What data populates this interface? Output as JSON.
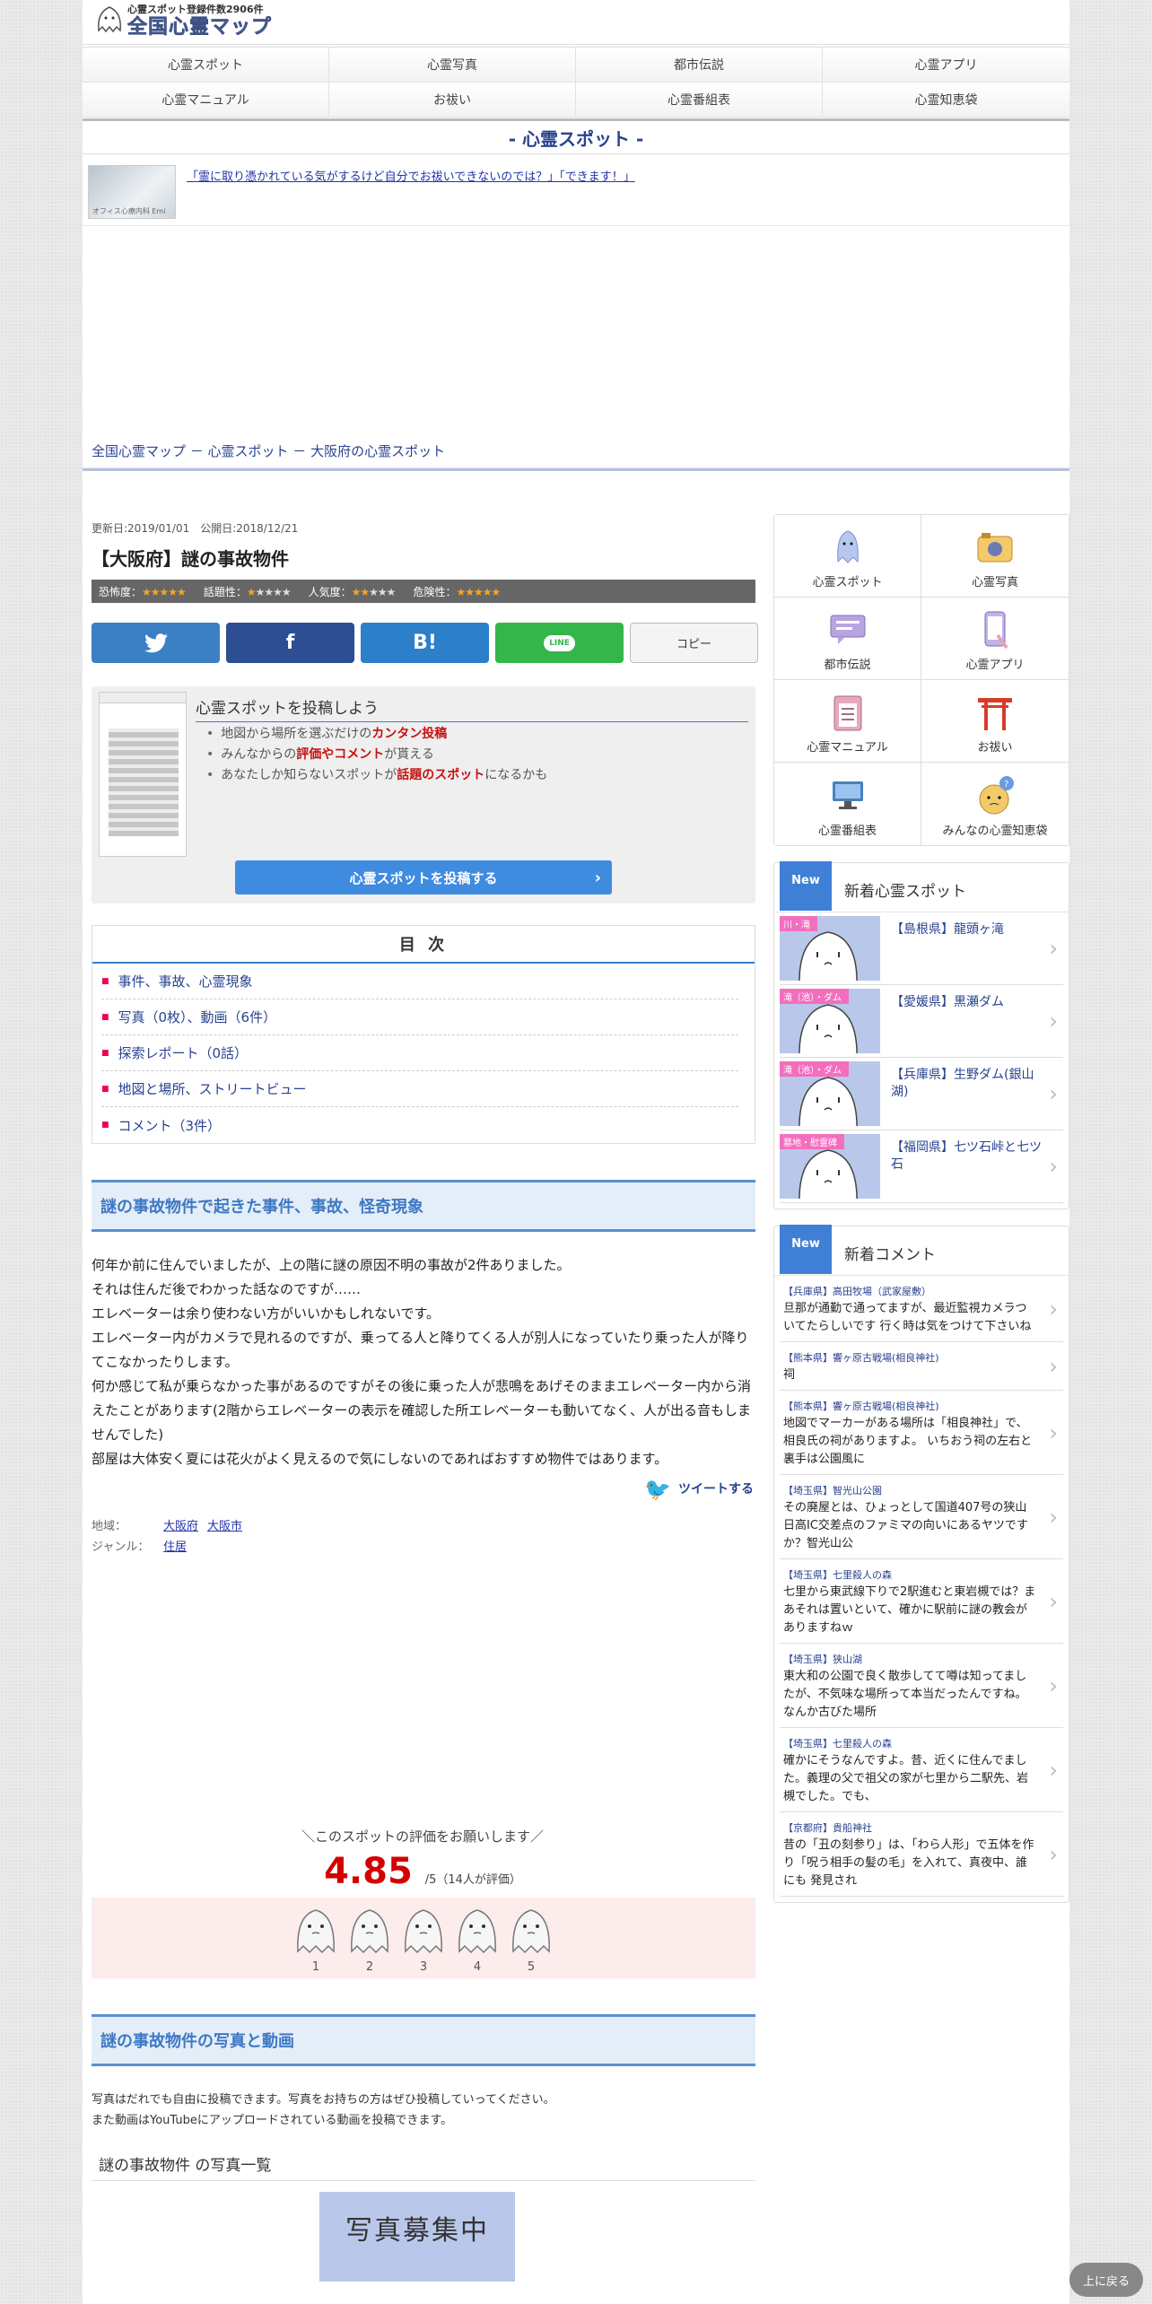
{
  "header": {
    "spot_count": "心霊スポット登録件数2906件",
    "site_name": "全国心霊マップ"
  },
  "nav": [
    {
      "label": "心霊スポット"
    },
    {
      "label": "心霊写真"
    },
    {
      "label": "都市伝説"
    },
    {
      "label": "心霊アプリ"
    },
    {
      "label": "心霊マニュアル"
    },
    {
      "label": "お祓い"
    },
    {
      "label": "心霊番組表"
    },
    {
      "label": "心霊知恵袋"
    }
  ],
  "section_title": "- 心霊スポット -",
  "ad": {
    "link_text": "「霊に取り憑かれている気がするけど自分でお祓いできないのでは？」「できます！」",
    "thumb_caption": "オフィス心療内科 Emi"
  },
  "breadcrumb": "全国心霊マップ － 心霊スポット － 大阪府の心霊スポット",
  "article": {
    "dates": "更新日:2019/01/01　公開日:2018/12/21",
    "title": "【大阪府】謎の事故物件",
    "ratings": [
      {
        "label": "恐怖度：",
        "on": "★★★★★",
        "off": ""
      },
      {
        "label": "話題性：",
        "on": "★",
        "off": "★★★★"
      },
      {
        "label": "人気度：",
        "on": "★★",
        "off": "★★★"
      },
      {
        "label": "危険性：",
        "on": "★★★★★",
        "off": ""
      }
    ],
    "share": {
      "twitter": "t",
      "facebook": "f",
      "hatena": "B!",
      "line": "LINE",
      "copy": "コピー"
    }
  },
  "post_box": {
    "title": "心霊スポットを投稿しよう",
    "items": [
      {
        "pre": "地図から場所を選ぶだけの",
        "hl": "カンタン投稿",
        "post": ""
      },
      {
        "pre": "みんなからの",
        "hl": "評価やコメント",
        "post": "が貰える"
      },
      {
        "pre": "あなたしか知らないスポットが",
        "hl": "話題のスポット",
        "post": "になるかも"
      }
    ],
    "button": "心霊スポットを投稿する"
  },
  "toc": {
    "title": "目 次",
    "items": [
      "事件、事故、心霊現象",
      "写真（0枚）、動画（6件）",
      "探索レポート（0話）",
      "地図と場所、ストリートビュー",
      "コメント（3件）"
    ]
  },
  "story": {
    "heading": "謎の事故物件で起きた事件、事故、怪奇現象",
    "lines": [
      "何年か前に住んでいましたが、上の階に謎の原因不明の事故が2件ありました。",
      "それは住んだ後でわかった話なのですが……",
      "エレベーターは余り使わない方がいいかもしれないです。",
      "エレベーター内がカメラで見れるのですが、乗ってる人と降りてくる人が別人になっていたり乗った人が降りてこなかったりします。",
      "何か感じて私が乗らなかった事があるのですがその後に乗った人が悲鳴をあげそのままエレベーター内から消えたことがあります(2階からエレベーターの表示を確認した所エレベーターも動いてなく、人が出る音もしませんでした)",
      "部屋は大体安く夏には花火がよく見えるので気にしないのであればおすすめ物件ではあります。"
    ],
    "tweet": "ツイートする",
    "region_label": "地域：",
    "region_pref": "大阪府",
    "region_city": "大阪市",
    "genre_label": "ジャンル：",
    "genre": "住居"
  },
  "evaluation": {
    "ask": "＼このスポットの評価をお願いします／",
    "score": "4.85",
    "suffix": "/5（14人が評価）",
    "options": [
      "1",
      "2",
      "3",
      "4",
      "5"
    ]
  },
  "photos": {
    "heading": "謎の事故物件の写真と動画",
    "intro1": "写真はだれでも自由に投稿できます。写真をお持ちの方はぜひ投稿していってください。",
    "intro2": "また動画はYouTubeにアップロードされている動画を投稿できます。",
    "list_title": "謎の事故物件 の写真一覧",
    "placeholder": "写真募集中"
  },
  "sidebar": {
    "categories": [
      "心霊スポット",
      "心霊写真",
      "都市伝説",
      "心霊アプリ",
      "心霊マニュアル",
      "お祓い",
      "心霊番組表",
      "みんなの心霊知恵袋"
    ],
    "new_badge": "New",
    "new_spots_title": "新着心霊スポット",
    "new_spots": [
      {
        "tag": "川・滝",
        "name": "【島根県】龍頭ヶ滝"
      },
      {
        "tag": "滝（池）・ダム",
        "name": "【愛媛県】黒瀬ダム"
      },
      {
        "tag": "滝（池）・ダム",
        "name": "【兵庫県】生野ダム(銀山湖)"
      },
      {
        "tag": "墓地・慰霊碑",
        "name": "【福岡県】七ツ石峠と七ツ石"
      }
    ],
    "new_comments_title": "新着コメント",
    "comments": [
      {
        "loc": "【兵庫県】高田牧場（武家屋敷）",
        "text": "旦那が通勤で通ってますが、最近監視カメラついてたらしいです 行く時は気をつけて下さいね"
      },
      {
        "loc": "【熊本県】響ヶ原古戦場(相良神社)",
        "text": "祠"
      },
      {
        "loc": "【熊本県】響ヶ原古戦場(相良神社)",
        "text": "地図でマーカーがある場所は「相良神社」で、相良氏の祠がありますよ。 いちおう祠の左右と裏手は公園風に"
      },
      {
        "loc": "【埼玉県】智光山公園",
        "text": "その廃屋とは、ひょっとして国道407号の狭山日高IC交差点のファミマの向いにあるヤツですか？智光山公"
      },
      {
        "loc": "【埼玉県】七里殺人の森",
        "text": "七里から東武線下りで2駅進むと東岩槻では？まあそれは置いといて、確かに駅前に謎の教会がありますねｗ"
      },
      {
        "loc": "【埼玉県】狭山湖",
        "text": "東大和の公園で良く散歩してて噂は知ってましたが、不気味な場所って本当だったんですね。なんか古びた場所"
      },
      {
        "loc": "【埼玉県】七里殺人の森",
        "text": "確かにそうなんですよ。昔、近くに住んでました。義理の父で祖父の家が七里から二駅先、岩槻でした。でも、"
      },
      {
        "loc": "【京都府】貴船神社",
        "text": "昔の「丑の刻参り」は、「わら人形」で五体を作り「呪う相手の髪の毛」を入れて、真夜中、誰にも 発見され"
      }
    ]
  },
  "back_to_top": "上に戻る"
}
